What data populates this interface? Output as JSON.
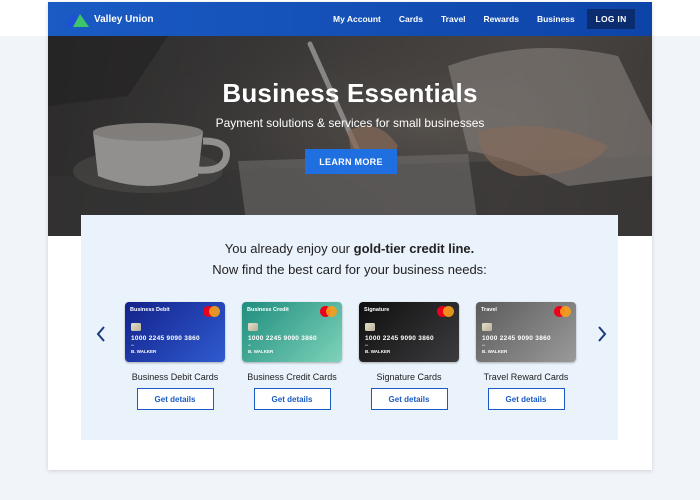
{
  "brand": {
    "name": "Valley Union"
  },
  "nav": {
    "items": [
      "My Account",
      "Cards",
      "Travel",
      "Rewards",
      "Business"
    ],
    "login_label": "LOG IN"
  },
  "hero": {
    "title": "Business Essentials",
    "subtitle": "Payment solutions & services for small businesses",
    "cta_label": "LEARN MORE"
  },
  "promo": {
    "line1_prefix": "You already enjoy our ",
    "line1_bold": "gold-tier credit line.",
    "line2": "Now find the best card for your business needs:"
  },
  "cards": [
    {
      "card_type": "Business Debit",
      "number": "1000 2245 9090 3860",
      "small_text": "•••",
      "holder": "B. WALKER",
      "label": "Business Debit Cards",
      "button": "Get details",
      "color_start": "#13228a",
      "color_end": "#2f5bd0"
    },
    {
      "card_type": "Business Credit",
      "number": "1000 2245 9090 3860",
      "small_text": "•••",
      "holder": "B. WALKER",
      "label": "Business Credit Cards",
      "button": "Get details",
      "color_start": "#1f8d7e",
      "color_end": "#7ed3b9"
    },
    {
      "card_type": "Signature",
      "number": "1000 2245 9090 3860",
      "small_text": "•••",
      "holder": "B. WALKER",
      "label": "Signature Cards",
      "button": "Get details",
      "color_start": "#0f0f10",
      "color_end": "#3c3c3e"
    },
    {
      "card_type": "Travel",
      "number": "1000 2245 9090 3860",
      "small_text": "•••",
      "holder": "B. WALKER",
      "label": "Travel Reward Cards",
      "button": "Get details",
      "color_start": "#5b5b5b",
      "color_end": "#9a9a9a"
    }
  ],
  "colors": {
    "nav_blue": "#1a5bc4",
    "cta_blue": "#1f6fe0",
    "login_navy": "#0b2c6e",
    "panel_bg": "#eaf2fb",
    "logo_blue": "#1f4fd6",
    "logo_green": "#3ec46b"
  },
  "icons": {
    "prev": "chevron-left-icon",
    "next": "chevron-right-icon",
    "network": "mastercard-logo-icon"
  }
}
